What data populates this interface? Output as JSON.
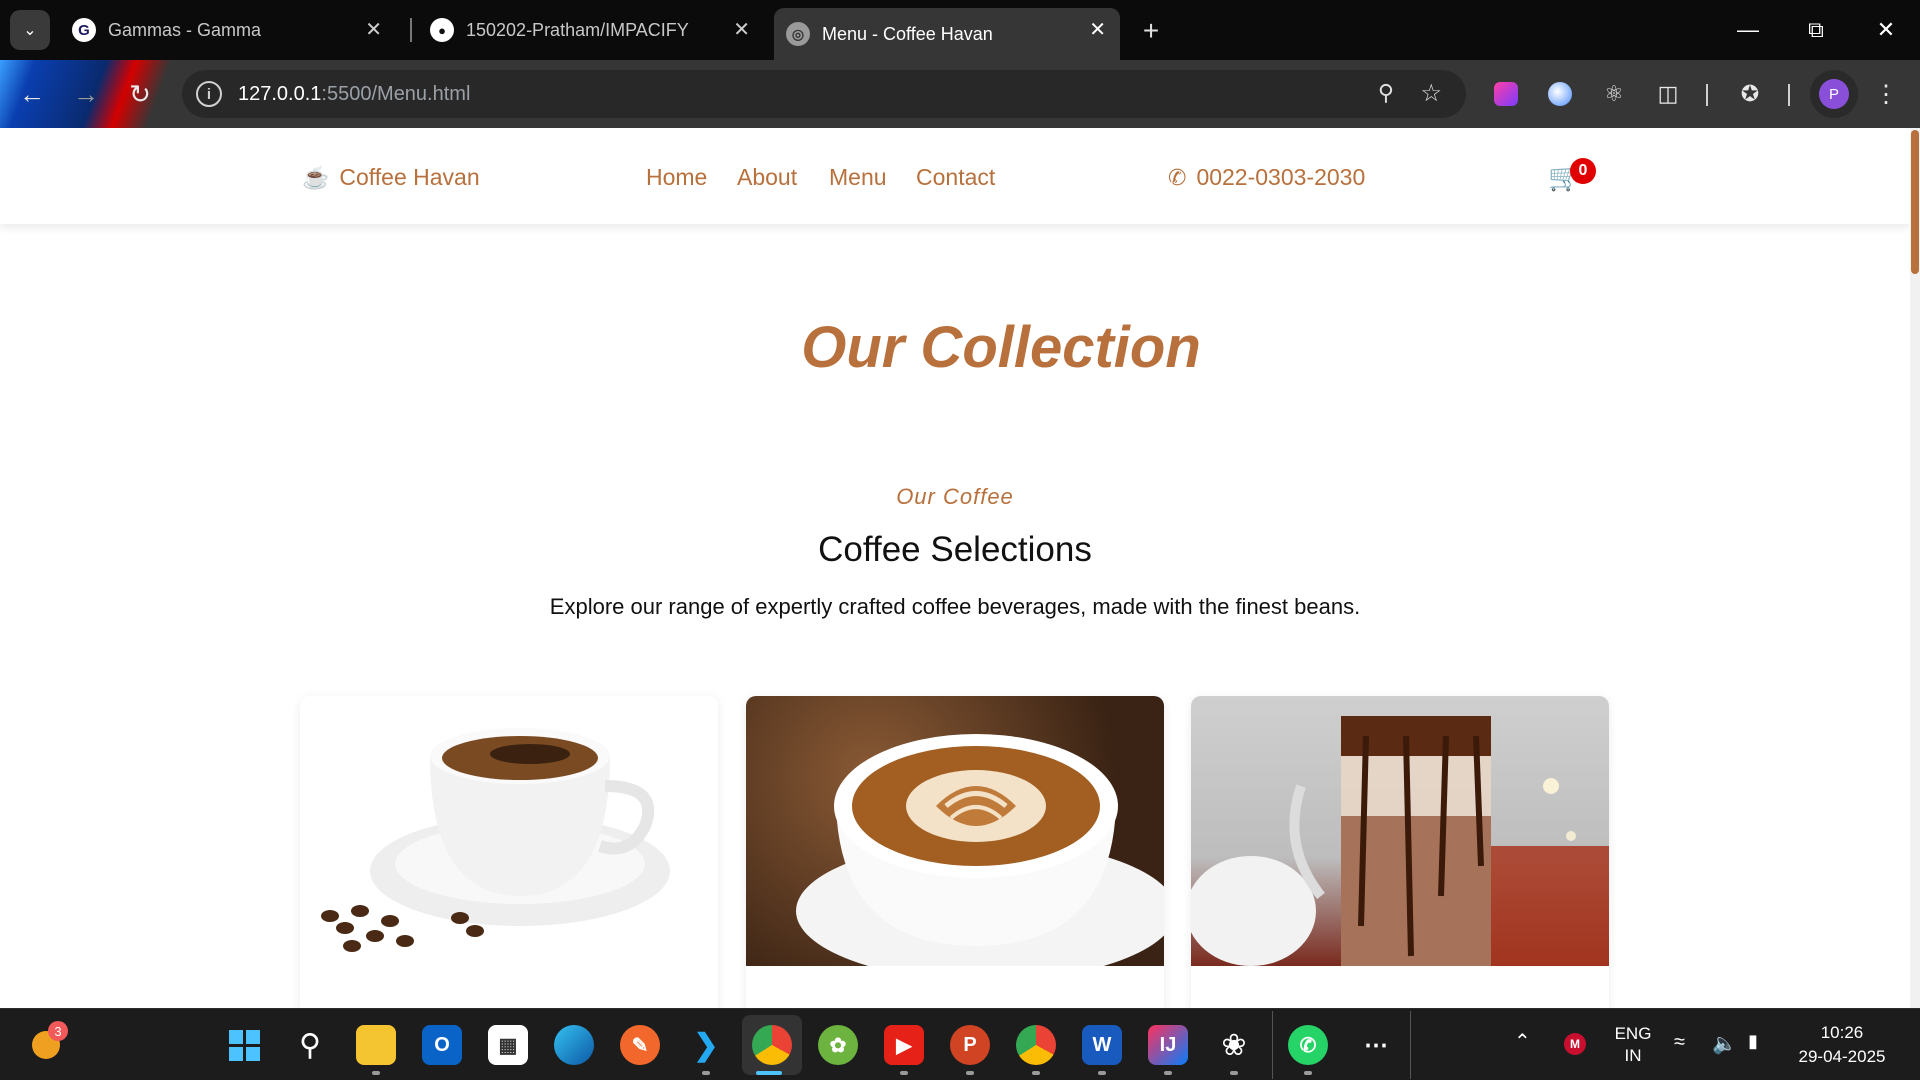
{
  "browser": {
    "tabs": [
      {
        "title": "Gammas - Gamma",
        "favicon": "G"
      },
      {
        "title": "150202-Pratham/IMPACIFY",
        "favicon": "github"
      },
      {
        "title": "Menu - Coffee Havan",
        "favicon": "globe"
      }
    ],
    "url_host": "127.0.0.1",
    "url_path": ":5500/Menu.html",
    "profile_initial": "P"
  },
  "site": {
    "brand": "Coffee Havan",
    "nav": [
      "Home",
      "About",
      "Menu",
      "Contact"
    ],
    "phone": "0022-0303-2030",
    "cart_count": "0",
    "collection_title": "Our Collection",
    "section": {
      "eyebrow": "Our Coffee",
      "title": "Coffee Selections",
      "description": "Explore our range of expertly crafted coffee beverages, made with the finest beans."
    },
    "accent_color": "#b8703c"
  },
  "taskbar": {
    "weather_badge": "3",
    "language": "ENG",
    "region": "IN",
    "time": "10:26",
    "date": "29-04-2025"
  }
}
